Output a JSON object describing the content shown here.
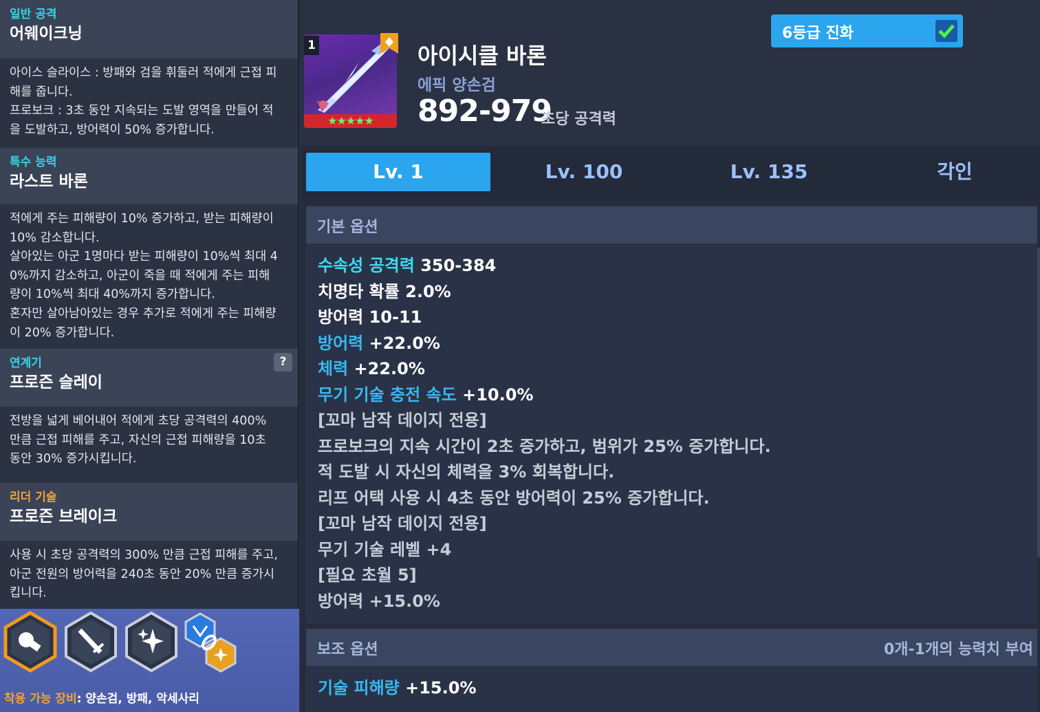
{
  "left": {
    "normal_attack": {
      "label": "일반 공격",
      "title": "어웨이크닝",
      "desc": "아이스 슬라이스 : 방패와 검을 휘둘러 적에게 근접 피\n해를 줍니다.\n프로보크 : 3초 동안 지속되는 도발 영역을 만들어 적\n을 도발하고, 방어력이 50% 증가합니다."
    },
    "special": {
      "label": "특수 능력",
      "title": "라스트 바론",
      "desc": "적에게 주는 피해량이 10% 증가하고, 받는 피해량이\n10% 감소합니다.\n살아있는 아군 1명마다 받는 피해량이 10%씩 최대 4\n0%까지 감소하고, 아군이 죽을 때 적에게 주는 피해\n량이 10%씩 최대 40%까지 증가합니다.\n혼자만 살아남아있는 경우 추가로 적에게 주는 피해량\n이 20% 증가합니다."
    },
    "chain": {
      "label": "연계기",
      "title": "프로즌 슬레이",
      "help": "?",
      "desc": "전방을 넓게 베어내어 적에게 초당 공격력의 400%\n만큼 근접 피해를 주고, 자신의 근접 피해량을 10초\n동안 30% 증가시킵니다."
    },
    "leader": {
      "label": "리더 기술",
      "title": "프로즌 브레이크",
      "desc": "사용 시 초당 공격력의 300% 만큼 근접 피해를 주고,\n아군 전원의 방어력을 240초 동안 20% 만큼 증가시\n킵니다."
    },
    "equip_label": "착용 가능 장비",
    "equip_value": ": 양손검, 방패, 악세사리"
  },
  "weapon": {
    "level_badge": "1",
    "name": "아이시클 바론",
    "type": "에픽 양손검",
    "damage": "892-979",
    "damage_unit": "초당 공격력",
    "stars": "★★★★★",
    "evolution_label": "6등급 진화",
    "evolution_checked": true
  },
  "tabs": [
    {
      "label": "Lv. 1",
      "active": true
    },
    {
      "label": "Lv. 100",
      "active": false
    },
    {
      "label": "Lv. 135",
      "active": false
    },
    {
      "label": "각인",
      "active": false
    }
  ],
  "basic_options": {
    "header": "기본 옵션",
    "lines": [
      {
        "key": "수속성 공격력",
        "value": "350-384",
        "style": "cyan"
      },
      {
        "key": "치명타 확률",
        "value": "2.0%",
        "style": "white"
      },
      {
        "key": "방어력",
        "value": "10-11",
        "style": "white"
      },
      {
        "key": "방어력",
        "value": "+22.0%",
        "style": "blue"
      },
      {
        "key": "체력",
        "value": "+22.0%",
        "style": "blue"
      },
      {
        "key": "무기 기술 충전 속도",
        "value": "+10.0%",
        "style": "blue"
      },
      {
        "key": "[꼬마 남작 데이지 전용]",
        "value": "",
        "style": "plain"
      },
      {
        "key": "프로보크의 지속 시간이 2초 증가하고, 범위가 25% 증가합니다.",
        "value": "",
        "style": "plain"
      },
      {
        "key": "적 도발 시 자신의 체력을 3% 회복합니다.",
        "value": "",
        "style": "plain"
      },
      {
        "key": "리프 어택 사용 시 4초 동안 방어력이 25% 증가합니다.",
        "value": "",
        "style": "plain"
      },
      {
        "key": "[꼬마 남작 데이지 전용]",
        "value": "",
        "style": "plain"
      },
      {
        "key": "무기 기술 레벨 +4",
        "value": "",
        "style": "plain"
      },
      {
        "key": "[필요 초월 5]",
        "value": "",
        "style": "plain"
      },
      {
        "key": "방어력 +15.0%",
        "value": "",
        "style": "plain"
      }
    ]
  },
  "sub_options": {
    "header": "보조 옵션",
    "note": "0개-1개의 능력치 부여",
    "lines": [
      {
        "key": "기술 피해량",
        "value": "+15.0%",
        "style": "blue"
      }
    ]
  },
  "colors": {
    "accent": "#2aa5ee",
    "cyan": "#3bdcee",
    "orange": "#f2a23a",
    "skillbar": "#5266b5"
  },
  "icons": [
    "shield-skill-icon",
    "sword-skill-icon",
    "sparkle-skill-icon",
    "chain-link-icon"
  ]
}
